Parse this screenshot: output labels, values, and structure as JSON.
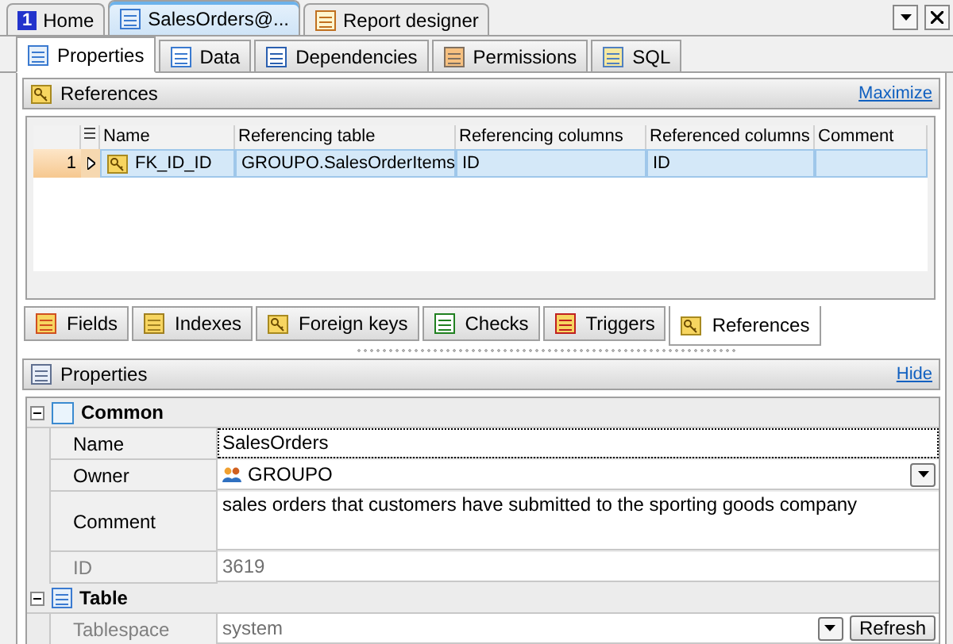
{
  "doc_tabs": [
    {
      "label": "Home",
      "badge": "1",
      "selected": false
    },
    {
      "label": "SalesOrders@...",
      "selected": true
    },
    {
      "label": "Report designer",
      "selected": false
    }
  ],
  "inner_tabs": [
    {
      "label": "Properties",
      "selected": true
    },
    {
      "label": "Data",
      "selected": false
    },
    {
      "label": "Dependencies",
      "selected": false
    },
    {
      "label": "Permissions",
      "selected": false
    },
    {
      "label": "SQL",
      "selected": false
    }
  ],
  "references_panel": {
    "title": "References",
    "action": "Maximize",
    "columns": [
      "Name",
      "Referencing table",
      "Referencing columns",
      "Referenced columns",
      "Comment"
    ],
    "rows": [
      {
        "number": "1",
        "selected": true,
        "cells": [
          "FK_ID_ID",
          "GROUPO.SalesOrderItems",
          "ID",
          "ID",
          ""
        ]
      }
    ]
  },
  "sub_tabs": [
    {
      "label": "Fields",
      "selected": false
    },
    {
      "label": "Indexes",
      "selected": false
    },
    {
      "label": "Foreign keys",
      "selected": false
    },
    {
      "label": "Checks",
      "selected": false
    },
    {
      "label": "Triggers",
      "selected": false
    },
    {
      "label": "References",
      "selected": true
    }
  ],
  "properties_panel": {
    "title": "Properties",
    "action": "Hide",
    "groups": [
      {
        "title": "Common",
        "expanded": true,
        "rows": [
          {
            "name": "Name",
            "value": "SalesOrders",
            "kind": "text",
            "disabled": false,
            "focused": true
          },
          {
            "name": "Owner",
            "value": "GROUPO",
            "kind": "owner",
            "disabled": false,
            "focused": false
          },
          {
            "name": "Comment",
            "value": "sales orders that customers have submitted to the sporting goods company",
            "kind": "memo",
            "disabled": false,
            "focused": false
          },
          {
            "name": "ID",
            "value": "3619",
            "kind": "text",
            "disabled": true,
            "focused": false
          }
        ]
      },
      {
        "title": "Table",
        "expanded": true,
        "rows": [
          {
            "name": "Tablespace",
            "value": "system",
            "kind": "refresh",
            "button": "Refresh",
            "disabled": true,
            "focused": false
          }
        ]
      }
    ]
  }
}
